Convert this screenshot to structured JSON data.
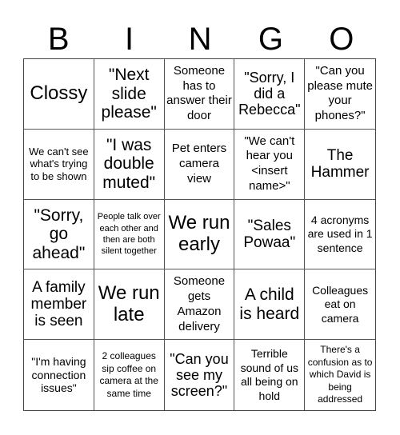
{
  "header": [
    "B",
    "I",
    "N",
    "G",
    "O"
  ],
  "cells": [
    "Clossy",
    "\"Next slide please\"",
    "Someone has to answer their door",
    "\"Sorry, I did a Rebecca\"",
    "\"Can you please mute your phones?\"",
    "We can't see what's trying to be shown",
    "\"I was double muted\"",
    "Pet enters camera view",
    "\"We can't hear you <insert name>\"",
    "The Hammer",
    "\"Sorry, go ahead\"",
    "People talk over each other and then are both silent together",
    "We run early",
    "\"Sales Powaa\"",
    "4 acronyms are used in 1 sentence",
    "A family member is seen",
    "We run late",
    "Someone gets Amazon delivery",
    "A child is heard",
    "Colleagues eat on camera",
    "\"I'm having connection issues\"",
    "2 colleagues sip coffee on camera at the same time",
    "\"Can you see my screen?\"",
    "Terrible sound of us all being on hold",
    "There's a confusion as to which David is being addressed"
  ]
}
